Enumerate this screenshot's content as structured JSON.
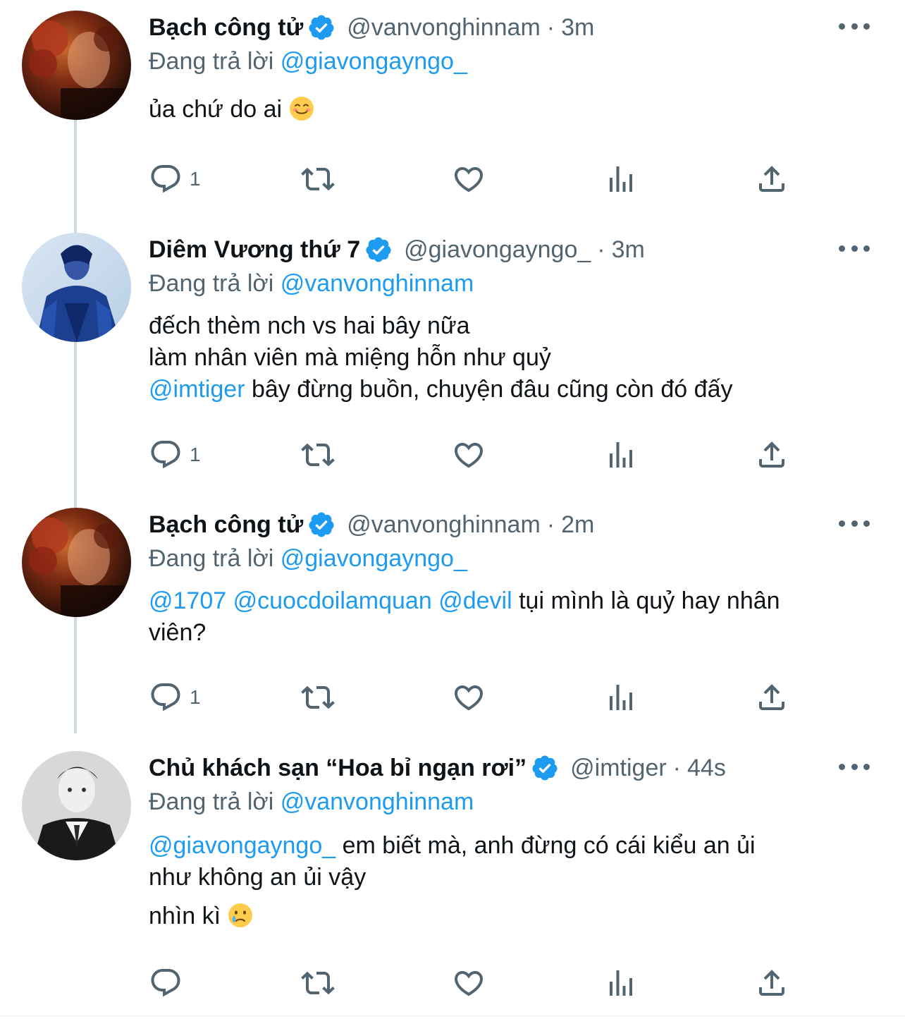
{
  "tweets": [
    {
      "name": "Bạch công tử",
      "handle": "@vanvonghinnam",
      "separator": "·",
      "time": "3m",
      "replying_prefix": "Đang trả lời",
      "replying_to": "@giavongayngo_",
      "body_text": "ủa chứ do ai",
      "body_emoji": "smiling-face-emoji",
      "reply_count": "1",
      "avatar": "avatar-red-roses"
    },
    {
      "name": "Diêm Vương thứ 7",
      "handle": "@giavongayngo_",
      "separator": "·",
      "time": "3m",
      "replying_prefix": "Đang trả lời",
      "replying_to": "@vanvonghinnam",
      "line1": "đếch thèm nch vs hai bây nữa",
      "line2": "làm nhân viên mà miệng hỗn như quỷ",
      "line3_mention": "@imtiger",
      "line3_text": " bây đừng buồn, chuyện đâu cũng còn đó đấy",
      "reply_count": "1",
      "avatar": "avatar-blue-denim"
    },
    {
      "name": "Bạch công tử",
      "handle": "@vanvonghinnam",
      "separator": "·",
      "time": "2m",
      "replying_prefix": "Đang trả lời",
      "replying_to": "@giavongayngo_",
      "mention1": "@1707",
      "mention2": "@cuocdoilamquan",
      "mention3": "@devil",
      "text_after": " tụi mình là quỷ hay nhân",
      "line2": "viên?",
      "reply_count": "1",
      "avatar": "avatar-red-roses"
    },
    {
      "name": "Chủ khách sạn “Hoa bỉ ngạn rơi”",
      "handle": "@imtiger",
      "separator": "·",
      "time": "44s",
      "replying_prefix": "Đang trả lời",
      "replying_to": "@vanvonghinnam",
      "line1_mention": "@giavongayngo_",
      "line1_text": " em biết mà, anh đừng có cái kiểu an ủi",
      "line2": "như không an ủi vậy",
      "line3": "nhìn kì",
      "line3_emoji": "crying-face-emoji",
      "reply_count": "",
      "avatar": "avatar-black-white-suit"
    }
  ],
  "colors": {
    "link_blue": "#1d9bf0",
    "secondary_text": "#536471",
    "thread_line": "#cfd9de",
    "verified_blue": "#1d9bf0"
  }
}
